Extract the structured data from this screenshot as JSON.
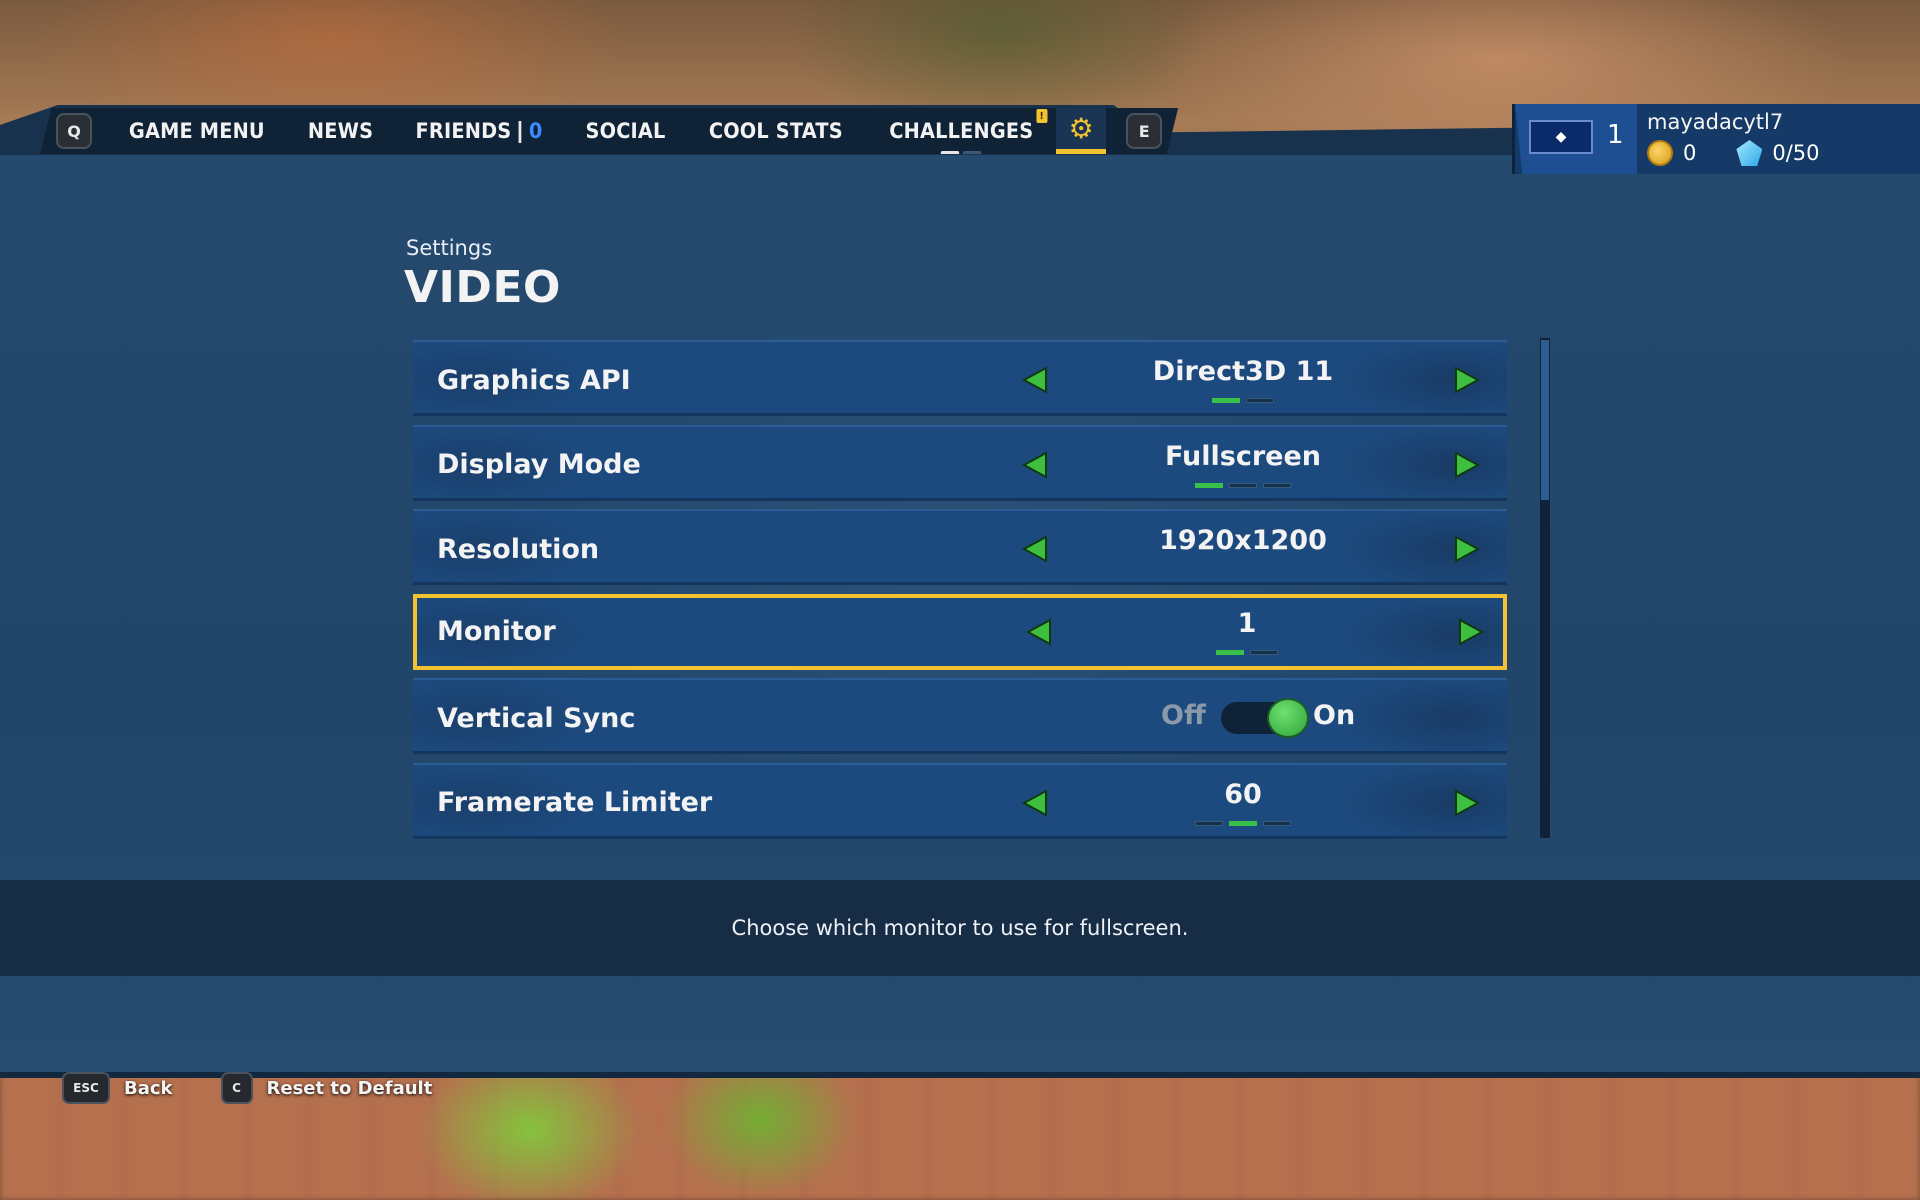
{
  "nav": {
    "left_key": "Q",
    "right_key": "E",
    "items": [
      "GAME MENU",
      "NEWS",
      "FRIENDS",
      "SOCIAL",
      "COOL STATS",
      "CHALLENGES"
    ],
    "friends_count": "0",
    "challenges_badge": "!",
    "active_tab_icon": "gear-icon"
  },
  "profile": {
    "level": "1",
    "username": "mayadacytl7",
    "coins": "0",
    "gems": "0/50"
  },
  "page": {
    "breadcrumb": "Settings",
    "title": "VIDEO"
  },
  "settings": [
    {
      "label": "Graphics API",
      "value": "Direct3D 11",
      "options": 2,
      "selected_index": 0
    },
    {
      "label": "Display Mode",
      "value": "Fullscreen",
      "options": 3,
      "selected_index": 0
    },
    {
      "label": "Resolution",
      "value": "1920x1200"
    },
    {
      "label": "Monitor",
      "value": "1",
      "options": 2,
      "selected_index": 0,
      "focused": true
    },
    {
      "label": "Vertical Sync",
      "toggle_off": "Off",
      "toggle_on": "On",
      "enabled": true
    },
    {
      "label": "Framerate Limiter",
      "value": "60",
      "options": 3,
      "selected_index": 1
    }
  ],
  "description": "Choose which monitor to use for fullscreen.",
  "hints": [
    {
      "key": "ESC",
      "label": "Back"
    },
    {
      "key": "C",
      "label": "Reset to Default"
    }
  ],
  "colors": {
    "accent": "#f2c230",
    "arrow": "#3fbf3f",
    "row": "#1c4a7e",
    "panel": "#22466a"
  }
}
